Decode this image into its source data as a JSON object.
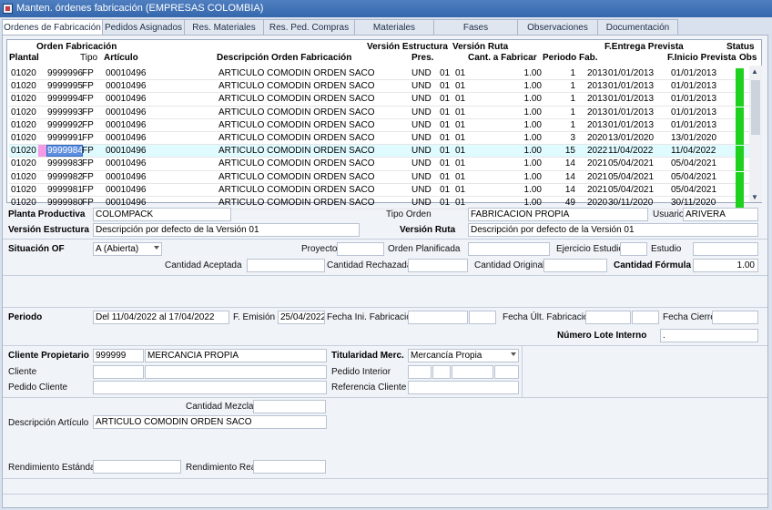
{
  "window": {
    "title": "Manten. órdenes fabricación (EMPRESAS COLOMBIA)"
  },
  "tabs": [
    "Ordenes de Fabricación",
    "Pedidos Asignados",
    "Res. Materiales",
    "Res. Ped. Compras",
    "Materiales",
    "Fases",
    "Observaciones",
    "Documentación"
  ],
  "grid": {
    "headers": {
      "orden_fab": "Orden Fabricación",
      "planta": "Plantal",
      "tipo": "Tipo",
      "articulo": "Artículo",
      "descripcion": "Descripción Orden Fabricación",
      "version_estructura": "Versión Estructura",
      "pres": "Pres.",
      "version_ruta": "Versión Ruta",
      "cant": "Cant. a Fabricar",
      "periodo_fab": "Periodo Fab.",
      "f_entrega": "F.Entrega Prevista",
      "f_inicio": "F.Inicio Prevista",
      "status": "Status",
      "obs": "Obs"
    },
    "rows": [
      {
        "planta": "01020",
        "of": "9999996",
        "tipo": "FP",
        "articulo": "00010496",
        "desc": "ARTICULO COMODIN ORDEN SACO",
        "pres": "UND",
        "ve": "01",
        "vr": "01",
        "cant": "1.00",
        "periodo": "1",
        "anio": "2013",
        "entrega": "01/01/2013",
        "inicio": "01/01/2013"
      },
      {
        "planta": "01020",
        "of": "9999995",
        "tipo": "FP",
        "articulo": "00010496",
        "desc": "ARTICULO COMODIN ORDEN SACO",
        "pres": "UND",
        "ve": "01",
        "vr": "01",
        "cant": "1.00",
        "periodo": "1",
        "anio": "2013",
        "entrega": "01/01/2013",
        "inicio": "01/01/2013"
      },
      {
        "planta": "01020",
        "of": "9999994",
        "tipo": "FP",
        "articulo": "00010496",
        "desc": "ARTICULO COMODIN ORDEN SACO",
        "pres": "UND",
        "ve": "01",
        "vr": "01",
        "cant": "1.00",
        "periodo": "1",
        "anio": "2013",
        "entrega": "01/01/2013",
        "inicio": "01/01/2013"
      },
      {
        "planta": "01020",
        "of": "9999993",
        "tipo": "FP",
        "articulo": "00010496",
        "desc": "ARTICULO COMODIN ORDEN SACO",
        "pres": "UND",
        "ve": "01",
        "vr": "01",
        "cant": "1.00",
        "periodo": "1",
        "anio": "2013",
        "entrega": "01/01/2013",
        "inicio": "01/01/2013"
      },
      {
        "planta": "01020",
        "of": "9999992",
        "tipo": "FP",
        "articulo": "00010496",
        "desc": "ARTICULO COMODIN ORDEN SACO",
        "pres": "UND",
        "ve": "01",
        "vr": "01",
        "cant": "1.00",
        "periodo": "1",
        "anio": "2013",
        "entrega": "01/01/2013",
        "inicio": "01/01/2013"
      },
      {
        "planta": "01020",
        "of": "9999991",
        "tipo": "FP",
        "articulo": "00010496",
        "desc": "ARTICULO COMODIN ORDEN SACO",
        "pres": "UND",
        "ve": "01",
        "vr": "01",
        "cant": "1.00",
        "periodo": "3",
        "anio": "2020",
        "entrega": "13/01/2020",
        "inicio": "13/01/2020"
      },
      {
        "planta": "01020",
        "of": "9999984",
        "tipo": "FP",
        "articulo": "00010496",
        "desc": "ARTICULO COMODIN ORDEN SACO",
        "pres": "UND",
        "ve": "01",
        "vr": "01",
        "cant": "1.00",
        "periodo": "15",
        "anio": "2022",
        "entrega": "11/04/2022",
        "inicio": "11/04/2022"
      },
      {
        "planta": "01020",
        "of": "9999983",
        "tipo": "FP",
        "articulo": "00010496",
        "desc": "ARTICULO COMODIN ORDEN SACO",
        "pres": "UND",
        "ve": "01",
        "vr": "01",
        "cant": "1.00",
        "periodo": "14",
        "anio": "2021",
        "entrega": "05/04/2021",
        "inicio": "05/04/2021"
      },
      {
        "planta": "01020",
        "of": "9999982",
        "tipo": "FP",
        "articulo": "00010496",
        "desc": "ARTICULO COMODIN ORDEN SACO",
        "pres": "UND",
        "ve": "01",
        "vr": "01",
        "cant": "1.00",
        "periodo": "14",
        "anio": "2021",
        "entrega": "05/04/2021",
        "inicio": "05/04/2021"
      },
      {
        "planta": "01020",
        "of": "9999981",
        "tipo": "FP",
        "articulo": "00010496",
        "desc": "ARTICULO COMODIN ORDEN SACO",
        "pres": "UND",
        "ve": "01",
        "vr": "01",
        "cant": "1.00",
        "periodo": "14",
        "anio": "2021",
        "entrega": "05/04/2021",
        "inicio": "05/04/2021"
      },
      {
        "planta": "01020",
        "of": "9999980",
        "tipo": "FP",
        "articulo": "00010496",
        "desc": "ARTICULO COMODIN ORDEN SACO",
        "pres": "UND",
        "ve": "01",
        "vr": "01",
        "cant": "1.00",
        "periodo": "49",
        "anio": "2020",
        "entrega": "30/11/2020",
        "inicio": "30/11/2020"
      }
    ],
    "selected_index": 6,
    "status_color": "#1fd11f",
    "selected_color": "#dffbff"
  },
  "form": {
    "planta_productiva": {
      "label": "Planta Productiva",
      "value": "COLOMPACK"
    },
    "tipo_orden": {
      "label": "Tipo Orden",
      "value": "FABRICACION PROPIA"
    },
    "usuario": {
      "label": "Usuario",
      "value": "ARIVERA"
    },
    "version_estructura": {
      "label": "Versión Estructura",
      "value": "Descripción por defecto de la Versión 01"
    },
    "version_ruta": {
      "label": "Versión Ruta",
      "value": "Descripción por defecto de la Versión 01"
    },
    "situacion_of": {
      "label": "Situación OF",
      "value": "A (Abierta)"
    },
    "proyecto": {
      "label": "Proyecto",
      "value": ""
    },
    "orden_planificada": {
      "label": "Orden Planificada",
      "value": ""
    },
    "ejercicio_estudio": {
      "label": "Ejercicio Estudio",
      "value": ""
    },
    "estudio": {
      "label": "Estudio",
      "value": ""
    },
    "cantidad_aceptada": {
      "label": "Cantidad Aceptada",
      "value": ""
    },
    "cantidad_rechazada": {
      "label": "Cantidad Rechazada",
      "value": ""
    },
    "cantidad_original": {
      "label": "Cantidad Original",
      "value": ""
    },
    "cantidad_formula": {
      "label": "Cantidad Fórmula",
      "value": "1.00"
    },
    "periodo": {
      "label": "Periodo",
      "value": "Del 11/04/2022 al 17/04/2022"
    },
    "f_emision": {
      "label": "F. Emisión",
      "value": "25/04/2022"
    },
    "fecha_ini_fab": {
      "label": "Fecha Ini. Fabricación",
      "value": ""
    },
    "fecha_ult_fab": {
      "label": "Fecha Últ. Fabricación",
      "value": ""
    },
    "fecha_cierre": {
      "label": "Fecha Cierre",
      "value": ""
    },
    "numero_lote": {
      "label": "Número Lote Interno",
      "value": "."
    },
    "cliente_propietario": {
      "label": "Cliente Propietario",
      "code": "999999",
      "name": "MERCANCIA PROPIA"
    },
    "titularidad": {
      "label": "Titularidad Merc.",
      "value": "Mercancía Propia"
    },
    "cliente": {
      "label": "Cliente",
      "code": "",
      "name": ""
    },
    "pedido_interior": {
      "label": "Pedido Interior"
    },
    "pedido_cliente": {
      "label": "Pedido Cliente",
      "value": ""
    },
    "referencia_cliente": {
      "label": "Referencia Cliente",
      "value": ""
    },
    "cantidad_mezcla": {
      "label": "Cantidad Mezcla",
      "value": ""
    },
    "descripcion_articulo": {
      "label": "Descripción Artículo",
      "value": "ARTICULO COMODIN ORDEN SACO"
    },
    "rendimiento_estandar": {
      "label": "Rendimiento Estándar",
      "value": ""
    },
    "rendimiento_real": {
      "label": "Rendimiento Real",
      "value": ""
    }
  }
}
